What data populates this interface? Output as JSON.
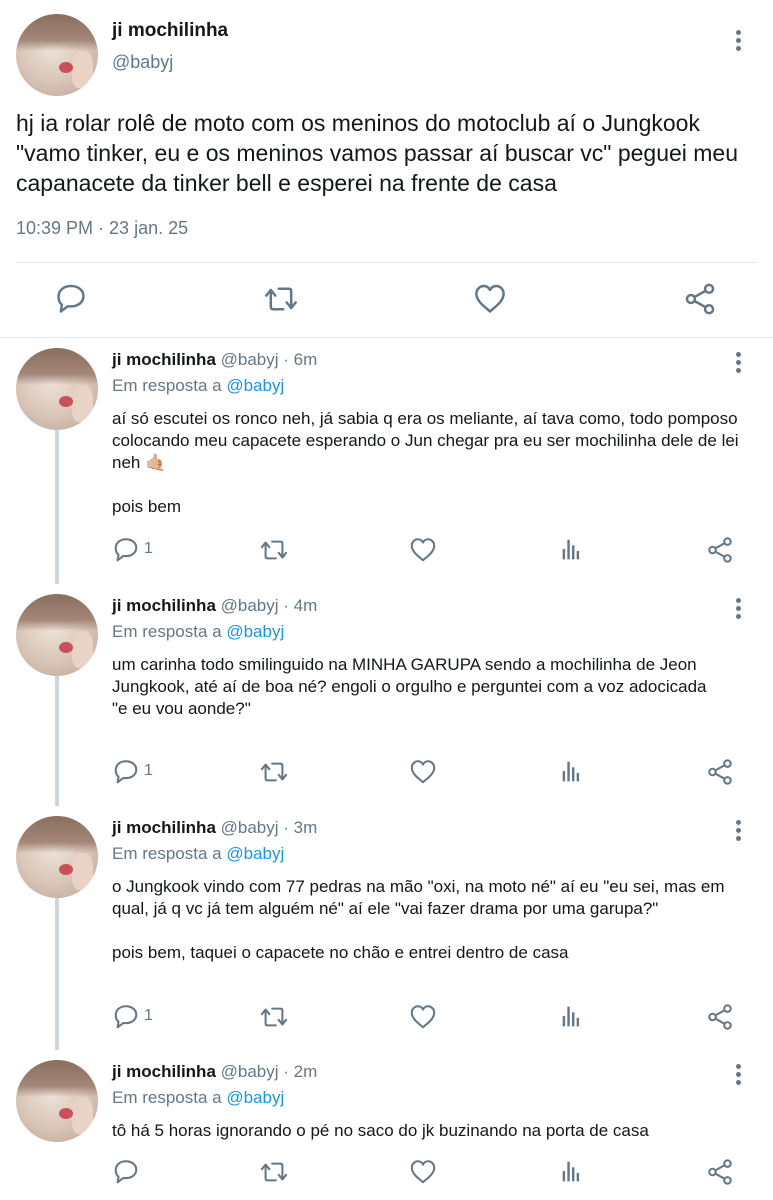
{
  "main_tweet": {
    "author_name": "ji mochilinha",
    "author_handle": "@babyj",
    "text": "hj ia rolar rolê de moto com os meninos do motoclub aí o Jungkook \"vamo tinker, eu e os meninos vamos passar aí buscar vc\" peguei meu capanacete da tinker bell e esperei na frente de casa",
    "timestamp": "10:39 PM · 23 jan. 25"
  },
  "replies": [
    {
      "author_name": "ji mochilinha",
      "author_handle": "@babyj",
      "time_ago": "· 6m",
      "in_reply_prefix": "Em resposta a",
      "in_reply_handle": "@babyj",
      "text": "aí só escutei os ronco neh, já sabia q era os meliante, aí tava como, todo pomposo colocando meu capacete esperando o Jun chegar pra eu ser mochilinha dele de lei neh 🤙🏼\n\npois bem",
      "reply_count": "1"
    },
    {
      "author_name": "ji mochilinha",
      "author_handle": "@babyj",
      "time_ago": "· 4m",
      "in_reply_prefix": "Em resposta a",
      "in_reply_handle": "@babyj",
      "text": "um carinha todo smilinguido na MINHA GARUPA sendo a mochilinha de Jeon Jungkook, até aí de boa né? engoli o orgulho e perguntei com a voz adocicada\n\"e eu vou aonde?\"",
      "reply_count": "1"
    },
    {
      "author_name": "ji mochilinha",
      "author_handle": "@babyj",
      "time_ago": "· 3m",
      "in_reply_prefix": "Em resposta a",
      "in_reply_handle": "@babyj",
      "text": "o Jungkook vindo com 77 pedras na mão \"oxi, na moto né\" aí eu \"eu sei, mas em qual, já q vc já tem alguém né\" aí ele \"vai fazer drama por uma garupa?\"\n\npois bem, taquei o capacete no chão e entrei dentro de casa",
      "reply_count": "1"
    },
    {
      "author_name": "ji mochilinha",
      "author_handle": "@babyj",
      "time_ago": "· 2m",
      "in_reply_prefix": "Em resposta a",
      "in_reply_handle": "@babyj",
      "text": "tô há 5 horas ignorando o pé no saco do jk buzinando na porta de casa",
      "reply_count": ""
    }
  ],
  "icons": {
    "reply": "reply-icon",
    "retweet": "retweet-icon",
    "like": "heart-icon",
    "analytics": "analytics-icon",
    "share": "share-icon",
    "more": "more-options-icon"
  },
  "colors": {
    "link": "#1b95e0",
    "muted": "#657786",
    "text": "#14171a",
    "divider": "#e1e8ed",
    "thread_line": "#ccd6dd"
  }
}
